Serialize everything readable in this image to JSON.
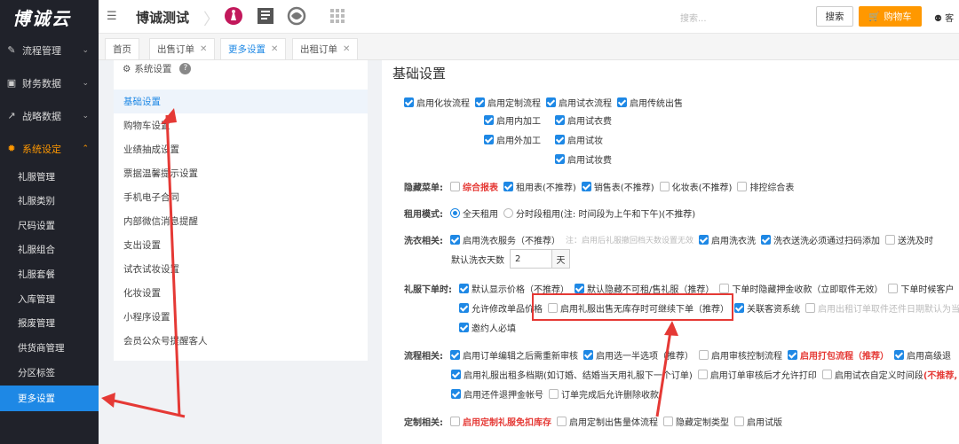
{
  "app": {
    "logo": "博诚云",
    "title": "博诚测试"
  },
  "header": {
    "search_placeholder": "搜索...",
    "search_button": "搜索",
    "cart_button": "购物车",
    "cart_icon": "cart-icon",
    "right_text": "客",
    "app_icons": [
      "princess-app-icon",
      "document-app-icon",
      "swirl-app-icon",
      "grid-apps-icon"
    ]
  },
  "sidebar": {
    "menus": [
      {
        "label": "流程管理",
        "icon": "wrench-icon"
      },
      {
        "label": "财务数据",
        "icon": "briefcase-icon"
      },
      {
        "label": "战略数据",
        "icon": "trend-icon"
      },
      {
        "label": "系统设定",
        "icon": "gear-icon"
      }
    ],
    "subs": [
      "礼服管理",
      "礼服类别",
      "尺码设置",
      "礼服组合",
      "礼服套餐",
      "入库管理",
      "报废管理",
      "供货商管理",
      "分区标签",
      "更多设置"
    ],
    "current_sub": "更多设置"
  },
  "tabs": [
    {
      "label": "首页",
      "closable": false
    },
    {
      "label": "出售订单",
      "closable": true
    },
    {
      "label": "更多设置",
      "closable": true
    },
    {
      "label": "出租订单",
      "closable": true
    }
  ],
  "left_panel": {
    "heading": "系统设置",
    "items": [
      "基础设置",
      "购物车设置",
      "业绩抽成设置",
      "票据温馨提示设置",
      "手机电子合同",
      "内部微信消息提醒",
      "支出设置",
      "试衣试妆设置",
      "化妆设置",
      "小程序设置",
      "会员公众号提醒客人"
    ],
    "current": "基础设置"
  },
  "main": {
    "title": "基础设置",
    "top_group": [
      {
        "label": "启用化妆流程",
        "checked": true
      },
      {
        "label": "启用定制流程",
        "checked": true
      },
      {
        "label": "启用试衣流程",
        "checked": true
      },
      {
        "label": "启用传统出售",
        "checked": true
      }
    ],
    "sub_col1": [
      {
        "label": "启用内加工",
        "checked": true
      },
      {
        "label": "启用外加工",
        "checked": true
      }
    ],
    "sub_col2": [
      {
        "label": "启用试衣费",
        "checked": true
      },
      {
        "label": "启用试妆",
        "checked": true
      },
      {
        "label": "启用试妆费",
        "checked": true
      }
    ],
    "hidden_menu": {
      "label": "隐藏菜单:",
      "items": [
        {
          "label": "综合报表",
          "checked": false,
          "red": true
        },
        {
          "label": "租用表(不推荐)",
          "checked": true
        },
        {
          "label": "销售表(不推荐)",
          "checked": true
        },
        {
          "label": "化妆表(不推荐)",
          "checked": false
        },
        {
          "label": "排控综合表",
          "checked": false
        }
      ]
    },
    "rent_mode": {
      "label": "租用模式:",
      "options": [
        {
          "label": "全天租用",
          "selected": true
        },
        {
          "label": "分时段租用(注: 时间段为上午和下午)(不推荐)",
          "selected": false
        }
      ]
    },
    "wash": {
      "label": "洗衣相关:",
      "service": {
        "label": "启用洗衣服务（不推荐）",
        "checked": true
      },
      "note": "注：启用后礼服撤回档天数设置无效",
      "items": [
        {
          "label": "启用洗衣洗",
          "checked": true
        },
        {
          "label": "洗衣送洗必须通过扫码添加",
          "checked": true
        },
        {
          "label": "送洗及时",
          "checked": false
        }
      ],
      "days_label": "默认洗衣天数",
      "days_value": "2",
      "days_unit": "天"
    },
    "dress_order": {
      "label": "礼服下单时:",
      "row1": [
        {
          "label": "默认显示价格（不推荐）",
          "checked": true
        },
        {
          "label": "默认隐藏不可租/售礼服（推荐）",
          "checked": true
        },
        {
          "label": "下单时隐藏押金收款（立即取件无效）",
          "checked": false
        },
        {
          "label": "下单时候客户",
          "checked": false
        }
      ],
      "row2": [
        {
          "label": "允许修改单品价格",
          "checked": true
        },
        {
          "label": "启用礼服出售无库存时可继续下单（推荐）",
          "checked": false
        },
        {
          "label": "关联客资系统",
          "checked": true
        },
        {
          "label": "启用出租订单取件还件日期默认为当天",
          "checked": false,
          "muted": true
        }
      ],
      "row3": [
        {
          "label": "邀约人必填",
          "checked": true
        }
      ]
    },
    "process": {
      "label": "流程相关:",
      "row1": [
        {
          "label": "启用订单编辑之后需重新审核",
          "checked": true
        },
        {
          "label": "启用选一半选项（推荐）",
          "checked": true
        },
        {
          "label": "启用审核控制流程",
          "checked": false
        },
        {
          "label": "启用打包流程（推荐）",
          "checked": true,
          "red": true
        },
        {
          "label": "启用高级退",
          "checked": true
        }
      ],
      "row2": [
        {
          "label": "启用礼服出租多档期(如订婚、结婚当天用礼服下一个订单)",
          "checked": true
        },
        {
          "label": "启用订单审核后才允许打印",
          "checked": false
        },
        {
          "label": "启用试衣自定义时间段",
          "checked": false
        },
        {
          "label": "(不推荐,",
          "red": true
        }
      ],
      "row3": [
        {
          "label": "启用还件退押金帐号",
          "checked": true
        },
        {
          "label": "订单完成后允许删除收款",
          "checked": false
        }
      ]
    },
    "custom": {
      "label": "定制相关:",
      "items": [
        {
          "label": "启用定制礼服免扣库存",
          "checked": false,
          "red": true
        },
        {
          "label": "启用定制出售量体流程",
          "checked": false
        },
        {
          "label": "隐藏定制类型",
          "checked": false
        },
        {
          "label": "启用试版",
          "checked": false
        }
      ]
    }
  },
  "annotation_colors": {
    "arrow": "#e53935",
    "accent": "#1e88e5",
    "cart": "#ff9800"
  }
}
